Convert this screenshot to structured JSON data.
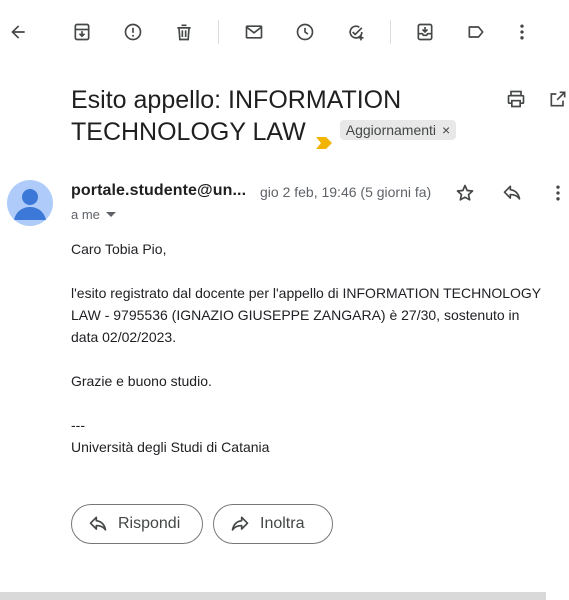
{
  "toolbar": {
    "icons": [
      "back-arrow-icon",
      "archive-icon",
      "report-spam-icon",
      "delete-icon",
      "mark-unread-icon",
      "snooze-icon",
      "add-task-icon",
      "move-to-icon",
      "label-icon",
      "more-vert-icon"
    ]
  },
  "email": {
    "subject": "Esito appello: INFORMATION TECHNOLOGY LAW",
    "label": "Aggiornamenti",
    "label_close": "×",
    "sender": "portale.studente@un...",
    "date": "gio 2 feb, 19:46 (5 giorni fa)",
    "to": "a me",
    "body": {
      "greeting": "Caro Tobia Pio,",
      "paragraph": "l'esito registrato dal docente per l'appello di INFORMATION TECHNOLOGY LAW - 9795536 (IGNAZIO GIUSEPPE ZANGARA) è 27/30, sostenuto in data 02/02/2023.",
      "closing": "Grazie e buono studio.",
      "signature_sep": "---",
      "signature": "Università degli Studi di Catania"
    }
  },
  "actions": {
    "reply": "Rispondi",
    "forward": "Inoltra"
  },
  "colors": {
    "important_marker": "#f2b400",
    "avatar_bg": "#aecbfa",
    "avatar_fg": "#3c78d8",
    "chip_bg": "#e8e8e8"
  }
}
